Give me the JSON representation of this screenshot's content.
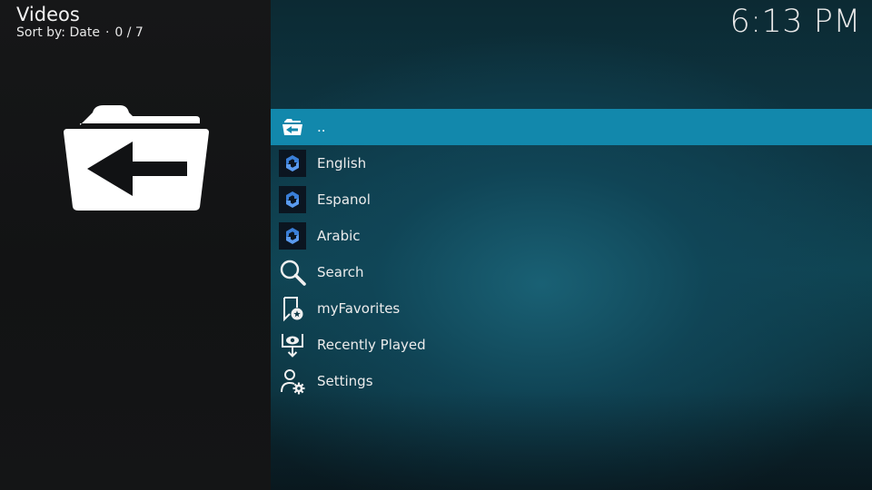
{
  "header": {
    "title": "Videos",
    "sort_label": "Sort by: Date",
    "separator": "·",
    "position": "0 / 7"
  },
  "clock": {
    "time": "6:13 PM"
  },
  "info_panel": {
    "icon": "folder-back-icon"
  },
  "list": {
    "items": [
      {
        "label": "..",
        "icon": "folder-back-icon",
        "selected": true
      },
      {
        "label": "English",
        "icon": "addon-logo-icon"
      },
      {
        "label": "Espanol",
        "icon": "addon-logo-icon"
      },
      {
        "label": "Arabic",
        "icon": "addon-logo-icon"
      },
      {
        "label": "Search",
        "icon": "search-icon"
      },
      {
        "label": "myFavorites",
        "icon": "favorites-icon"
      },
      {
        "label": "Recently Played",
        "icon": "recently-played-icon"
      },
      {
        "label": "Settings",
        "icon": "settings-icon"
      }
    ]
  },
  "colors": {
    "selection": "#1288ac",
    "left_panel": "#141516",
    "background_teal": "#0f4452",
    "logo_blue": "#3a7fd8"
  }
}
